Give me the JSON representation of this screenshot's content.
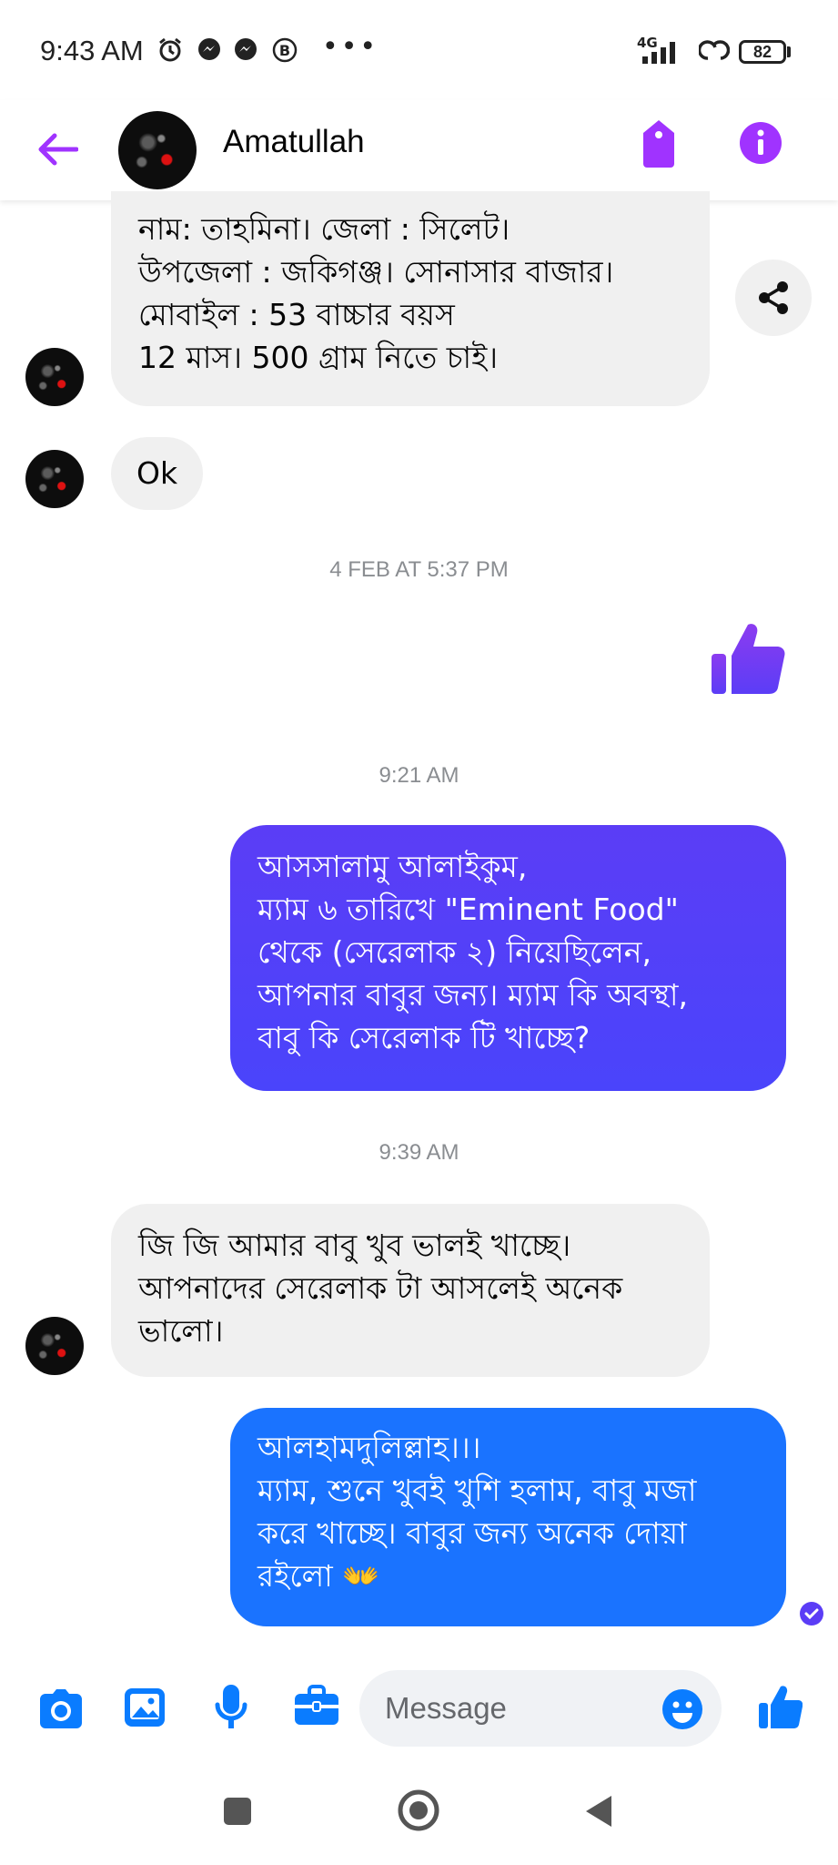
{
  "status_bar": {
    "time": "9:43 AM",
    "network": "4G",
    "battery": "82",
    "icons": [
      "alarm-icon",
      "messenger-icon",
      "messenger-icon",
      "b-badge-icon",
      "more-dots-icon",
      "signal-icon",
      "hotspot-icon",
      "battery-icon"
    ]
  },
  "header": {
    "contact_name": "Amatullah",
    "icons": [
      "back-arrow-icon",
      "tag-icon",
      "info-icon"
    ],
    "accent_color": "#a033ff"
  },
  "messages": {
    "m1": "নাম: তাহমিনা। জেলা : সিলেট।\nউপজেলা : জকিগঞ্জ। সোনাসার বাজার।\nমোবাইল :          53 বাচ্চার বয়স\n12 মাস। 500 গ্রাম নিতে চাই।",
    "m2": "Ok",
    "ts1": "4 FEB AT 5:37 PM",
    "ts2": "9:21 AM",
    "m3": "আসসালামু আলাইকুম,\nম্যাম ৬ তারিখে \"Eminent Food\"\nথেকে (সেরেলাক ২) নিয়েছিলেন,\nআপনার বাবুর জন্য। ম্যাম কি অবস্থা,\nবাবু কি সেরেলাক টি খাচ্ছে?",
    "ts3": "9:39 AM",
    "m4": "জি জি আমার বাবু খুব ভালই খাচ্ছে।\nআপনাদের সেরেলাক টা আসলেই অনেক\nভালো।",
    "m5": "আলহামদুলিল্লাহ।।।\nম্যাম, শুনে খুবই খুশি হলাম, বাবু মজা\nকরে খাচ্ছে। বাবুর জন্য অনেক দোয়া\nরইলো 👐"
  },
  "composer": {
    "placeholder": "Message",
    "icons": [
      "camera-icon",
      "gallery-icon",
      "microphone-icon",
      "briefcase-icon",
      "emoji-icon",
      "like-icon"
    ],
    "accent_color": "#0a7cff"
  },
  "colors": {
    "outgoing_top": "#5b3df6",
    "outgoing_bottom": "#1a73ff",
    "incoming_bubble": "#f0f0f0",
    "timestamp": "#8a8d91"
  }
}
